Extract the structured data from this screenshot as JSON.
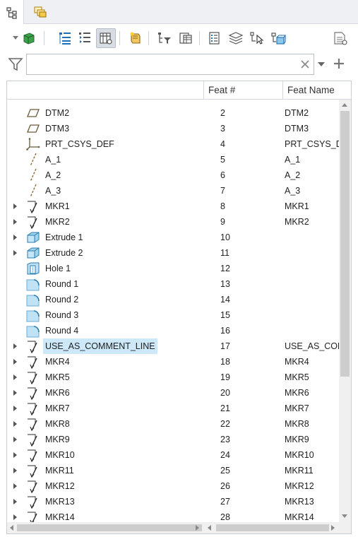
{
  "tabs": [
    {
      "icon": "model-tree-icon"
    },
    {
      "icon": "layers-icon"
    }
  ],
  "toolbar": {
    "buttons": [
      {
        "icon": "display-style-icon"
      },
      {
        "icon": "expand-tree-icon"
      },
      {
        "icon": "collapse-tree-icon"
      },
      {
        "icon": "tree-columns-icon",
        "pressed": true
      },
      {
        "icon": "insert-marker-icon"
      },
      {
        "icon": "filter-tree-icon"
      },
      {
        "icon": "tree-settings-icon"
      },
      {
        "icon": "properties-icon"
      },
      {
        "icon": "layer-tree-icon"
      },
      {
        "icon": "select-icon"
      },
      {
        "icon": "model-icon"
      },
      {
        "icon": "page-settings-icon"
      }
    ]
  },
  "filter": {
    "value": "",
    "placeholder": ""
  },
  "columns": {
    "col1": "",
    "col2": "Feat #",
    "col3": "Feat Name"
  },
  "rows": [
    {
      "name": "DTM2",
      "num": "2",
      "feat_name": "DTM2",
      "icon": "datum-plane",
      "expandable": false,
      "selected": false
    },
    {
      "name": "DTM3",
      "num": "3",
      "feat_name": "DTM3",
      "icon": "datum-plane",
      "expandable": false,
      "selected": false
    },
    {
      "name": "PRT_CSYS_DEF",
      "num": "4",
      "feat_name": "PRT_CSYS_DEF",
      "icon": "csys",
      "expandable": false,
      "selected": false
    },
    {
      "name": "A_1",
      "num": "5",
      "feat_name": "A_1",
      "icon": "axis",
      "expandable": false,
      "selected": false
    },
    {
      "name": "A_2",
      "num": "6",
      "feat_name": "A_2",
      "icon": "axis",
      "expandable": false,
      "selected": false
    },
    {
      "name": "A_3",
      "num": "7",
      "feat_name": "A_3",
      "icon": "axis",
      "expandable": false,
      "selected": false
    },
    {
      "name": "MKR1",
      "num": "8",
      "feat_name": "MKR1",
      "icon": "marker",
      "expandable": true,
      "selected": false
    },
    {
      "name": "MKR2",
      "num": "9",
      "feat_name": "MKR2",
      "icon": "marker",
      "expandable": true,
      "selected": false
    },
    {
      "name": "Extrude 1",
      "num": "10",
      "feat_name": "",
      "icon": "extrude",
      "expandable": true,
      "selected": false
    },
    {
      "name": "Extrude 2",
      "num": "11",
      "feat_name": "",
      "icon": "extrude",
      "expandable": true,
      "selected": false
    },
    {
      "name": "Hole 1",
      "num": "12",
      "feat_name": "",
      "icon": "hole",
      "expandable": false,
      "selected": false
    },
    {
      "name": "Round 1",
      "num": "13",
      "feat_name": "",
      "icon": "round",
      "expandable": false,
      "selected": false
    },
    {
      "name": "Round 2",
      "num": "14",
      "feat_name": "",
      "icon": "round",
      "expandable": false,
      "selected": false
    },
    {
      "name": "Round 3",
      "num": "15",
      "feat_name": "",
      "icon": "round",
      "expandable": false,
      "selected": false
    },
    {
      "name": "Round 4",
      "num": "16",
      "feat_name": "",
      "icon": "round",
      "expandable": false,
      "selected": false
    },
    {
      "name": "USE_AS_COMMENT_LINE",
      "num": "17",
      "feat_name": "USE_AS_COMMENT_LINE",
      "icon": "marker",
      "expandable": true,
      "selected": true
    },
    {
      "name": "MKR4",
      "num": "18",
      "feat_name": "MKR4",
      "icon": "marker",
      "expandable": true,
      "selected": false
    },
    {
      "name": "MKR5",
      "num": "19",
      "feat_name": "MKR5",
      "icon": "marker",
      "expandable": true,
      "selected": false
    },
    {
      "name": "MKR6",
      "num": "20",
      "feat_name": "MKR6",
      "icon": "marker",
      "expandable": true,
      "selected": false
    },
    {
      "name": "MKR7",
      "num": "21",
      "feat_name": "MKR7",
      "icon": "marker",
      "expandable": true,
      "selected": false
    },
    {
      "name": "MKR8",
      "num": "22",
      "feat_name": "MKR8",
      "icon": "marker",
      "expandable": true,
      "selected": false
    },
    {
      "name": "MKR9",
      "num": "23",
      "feat_name": "MKR9",
      "icon": "marker",
      "expandable": true,
      "selected": false
    },
    {
      "name": "MKR10",
      "num": "24",
      "feat_name": "MKR10",
      "icon": "marker",
      "expandable": true,
      "selected": false
    },
    {
      "name": "MKR11",
      "num": "25",
      "feat_name": "MKR11",
      "icon": "marker",
      "expandable": true,
      "selected": false
    },
    {
      "name": "MKR12",
      "num": "26",
      "feat_name": "MKR12",
      "icon": "marker",
      "expandable": true,
      "selected": false
    },
    {
      "name": "MKR13",
      "num": "27",
      "feat_name": "MKR13",
      "icon": "marker",
      "expandable": true,
      "selected": false
    },
    {
      "name": "MKR14",
      "num": "28",
      "feat_name": "MKR14",
      "icon": "marker",
      "expandable": true,
      "selected": false
    }
  ],
  "colors": {
    "selection": "#cde8f8",
    "extrude_fill": "#9fd3ee",
    "marker_arrow": "#555555"
  }
}
